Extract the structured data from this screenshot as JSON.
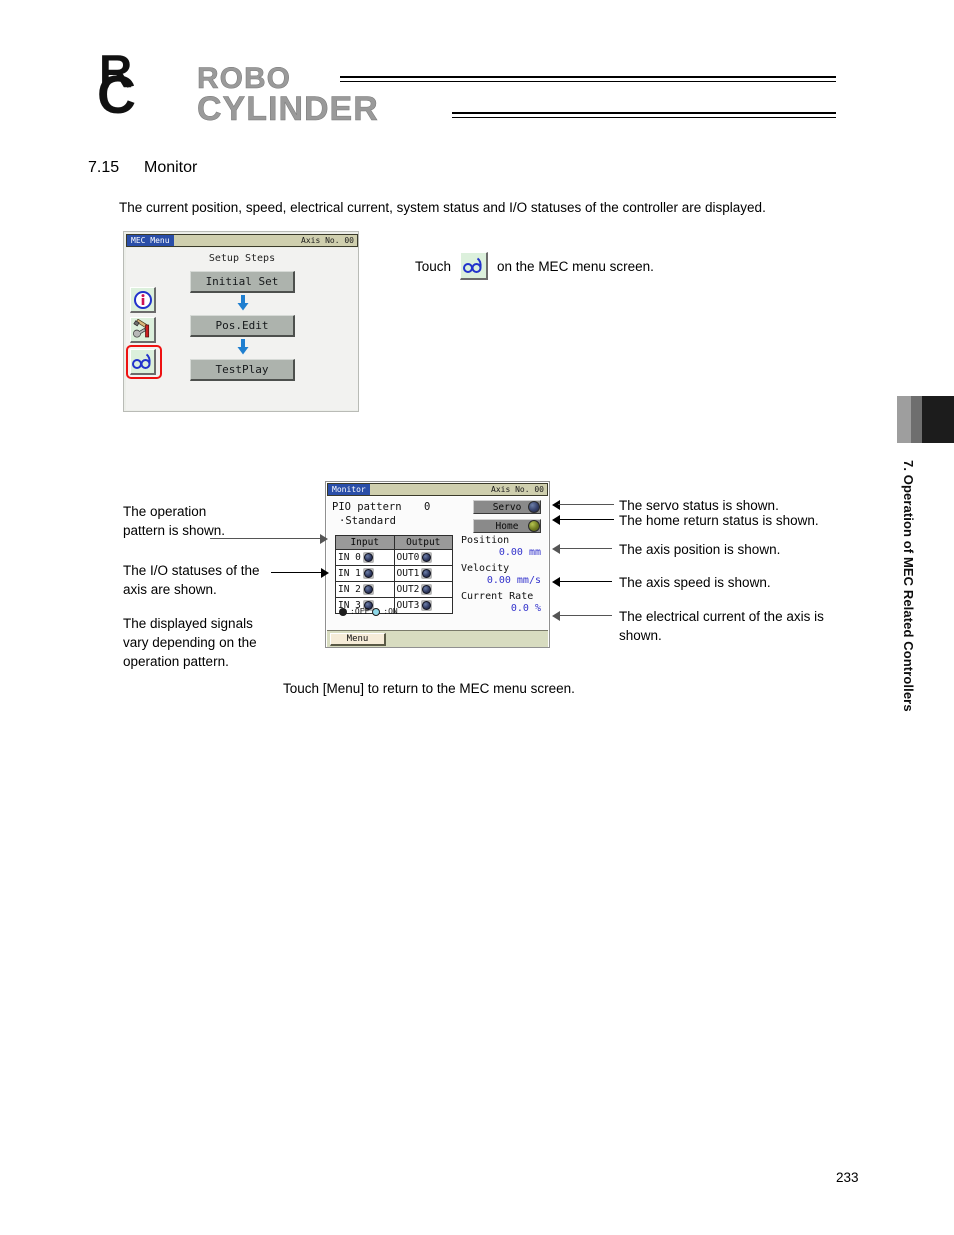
{
  "header": {
    "logo_r": "R",
    "logo_c": "C",
    "logo_word_top": "ROBO",
    "logo_word_bottom": "CYLINDER"
  },
  "section": {
    "number": "7.15",
    "title": "Monitor",
    "intro": "The current position, speed, electrical current, system status and I/O statuses of the controller are displayed."
  },
  "mec_screen": {
    "title": "MEC Menu",
    "axis": "Axis No. 00",
    "setup_steps_label": "Setup Steps",
    "steps": [
      {
        "label": "Initial Set"
      },
      {
        "label": "Pos.Edit"
      },
      {
        "label": "TestPlay"
      }
    ],
    "side_icons": [
      {
        "name": "info-icon"
      },
      {
        "name": "tools-icon"
      },
      {
        "name": "monitor-glasses-icon"
      }
    ]
  },
  "touch_instruction": {
    "prefix": "Touch",
    "icon": "monitor-glasses-icon",
    "suffix": "on the MEC menu screen."
  },
  "monitor_screen": {
    "title": "Monitor",
    "axis": "Axis No. 00",
    "pio_label": "PIO pattern",
    "pio_value": "0",
    "pio_sub": "·Standard",
    "servo_label": "Servo",
    "home_label": "Home",
    "servo_led_state": "off",
    "home_led_state": "on",
    "io_headers": [
      "Input",
      "Output"
    ],
    "io_rows": [
      {
        "input": "IN 0",
        "input_state": "off",
        "output": "OUT0",
        "output_state": "off"
      },
      {
        "input": "IN 1",
        "input_state": "off",
        "output": "OUT1",
        "output_state": "off"
      },
      {
        "input": "IN 2",
        "input_state": "off",
        "output": "OUT2",
        "output_state": "off"
      },
      {
        "input": "IN 3",
        "input_state": "off",
        "output": "OUT3",
        "output_state": "off"
      }
    ],
    "legend_off": ":OFF",
    "legend_on": ":ON",
    "readouts": [
      {
        "label": "Position",
        "value": "0.00 mm"
      },
      {
        "label": "Velocity",
        "value": "0.00 mm/s"
      },
      {
        "label": "Current Rate",
        "value": "0.0 %"
      }
    ],
    "menu_button": "Menu"
  },
  "callouts": {
    "left": [
      {
        "id": "operation-pattern",
        "text": "The operation\npattern is shown."
      },
      {
        "id": "io-statuses",
        "text": "The I/O statuses of the\naxis are shown."
      },
      {
        "id": "displayed-signals",
        "text": "The displayed signals\nvary depending on the\noperation pattern."
      }
    ],
    "right": [
      {
        "id": "servo-status",
        "text": "The servo status is shown."
      },
      {
        "id": "home-status",
        "text": "The home return status is shown."
      },
      {
        "id": "axis-position",
        "text": "The axis position is shown."
      },
      {
        "id": "axis-speed",
        "text": "The axis speed is shown."
      },
      {
        "id": "axis-current",
        "text": "The electrical current of the axis is\nshown."
      }
    ]
  },
  "bottom_note": "Touch [Menu] to return to the MEC menu screen.",
  "side_tab": {
    "text": "7. Operation of MEC Related Controllers"
  },
  "page_number": "233",
  "colors": {
    "accent_blue": "#2a4ea8",
    "value_blue": "#3333cc",
    "highlight_red": "#ee1111",
    "lcd_beige": "#cfcfae",
    "icon_green": "#dcf0dc"
  }
}
